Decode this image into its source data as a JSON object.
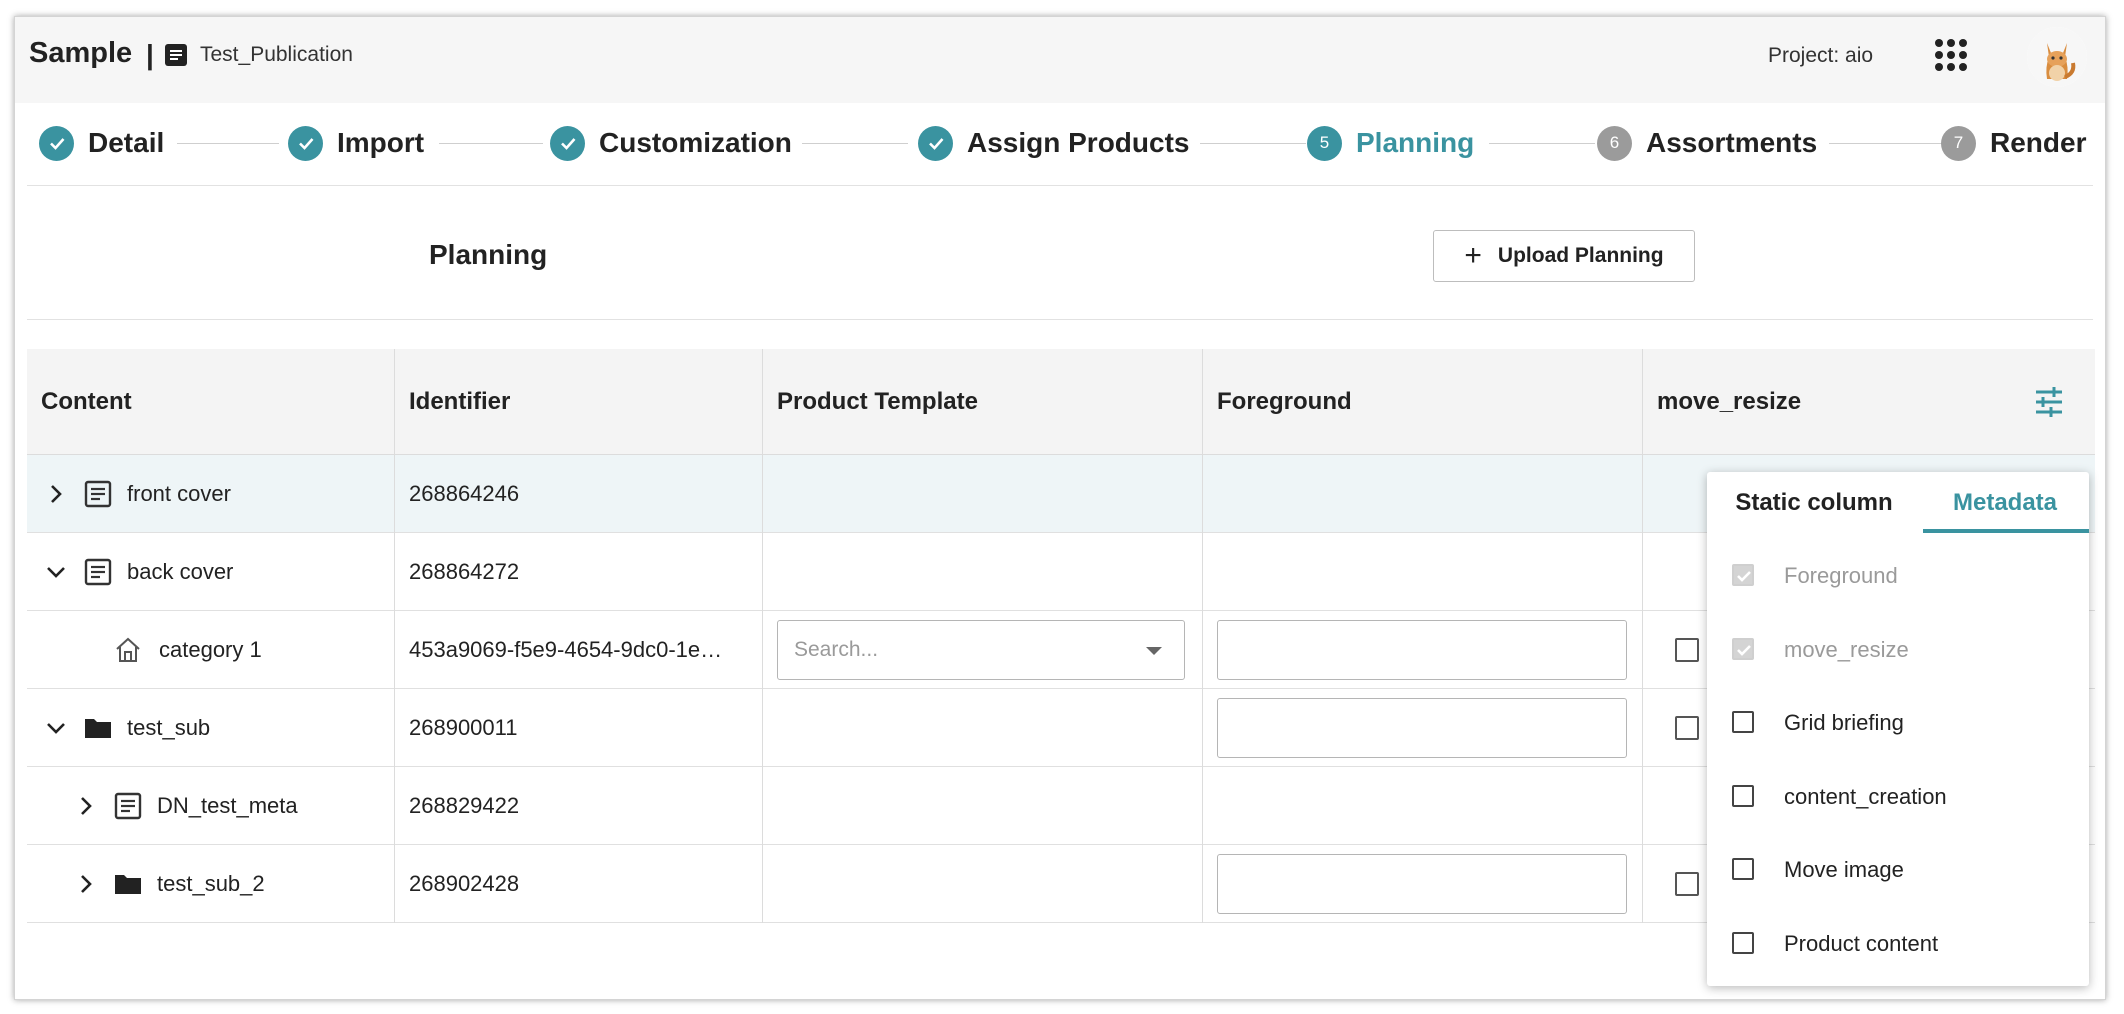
{
  "header": {
    "brand": "Sample",
    "separator": "|",
    "publication": "Test_Publication",
    "project": "Project: aio"
  },
  "stepper": {
    "steps": [
      {
        "label": "Detail",
        "status": "done",
        "number": "1"
      },
      {
        "label": "Import",
        "status": "done",
        "number": "2"
      },
      {
        "label": "Customization",
        "status": "done",
        "number": "3"
      },
      {
        "label": "Assign Products",
        "status": "done",
        "number": "4"
      },
      {
        "label": "Planning",
        "status": "active",
        "number": "5"
      },
      {
        "label": "Assortments",
        "status": "todo",
        "number": "6"
      },
      {
        "label": "Render",
        "status": "todo",
        "number": "7"
      }
    ]
  },
  "planning": {
    "title": "Planning",
    "upload_label": "Upload Planning",
    "upload_icon": "+"
  },
  "table": {
    "columns": [
      "Content",
      "Identifier",
      "Product Template",
      "Foreground",
      "move_resize"
    ],
    "rows": [
      {
        "name": "front cover",
        "identifier": "268864246",
        "icon": "document-icon",
        "expander": "collapsed"
      },
      {
        "name": "back cover",
        "identifier": "268864272",
        "icon": "document-icon",
        "expander": "expanded"
      },
      {
        "name": "category 1",
        "identifier": "453a9069-f5e9-4654-9dc0-1e…",
        "icon": "home-icon",
        "expander": "none",
        "template_placeholder": "Search..."
      },
      {
        "name": "test_sub",
        "identifier": "268900011",
        "icon": "folder-icon",
        "expander": "expanded"
      },
      {
        "name": "DN_test_meta",
        "identifier": "268829422",
        "icon": "document-icon",
        "expander": "collapsed"
      },
      {
        "name": "test_sub_2",
        "identifier": "268902428",
        "icon": "folder-icon",
        "expander": "collapsed"
      }
    ]
  },
  "column_popup": {
    "tabs": [
      "Static column",
      "Metadata"
    ],
    "active_tab": "Metadata",
    "items": [
      {
        "label": "Foreground",
        "checked": true,
        "disabled": true
      },
      {
        "label": "move_resize",
        "checked": true,
        "disabled": true
      },
      {
        "label": "Grid briefing",
        "checked": false,
        "disabled": false
      },
      {
        "label": "content_creation",
        "checked": false,
        "disabled": false
      },
      {
        "label": "Move image",
        "checked": false,
        "disabled": false
      },
      {
        "label": "Product content",
        "checked": false,
        "disabled": false
      }
    ]
  },
  "colors": {
    "accent": "#3a93a0",
    "pending_step": "#9b9b9b",
    "row_highlight": "#eef5f7",
    "header_bg": "#f4f4f4",
    "topbar_bg": "#f6f6f6"
  }
}
